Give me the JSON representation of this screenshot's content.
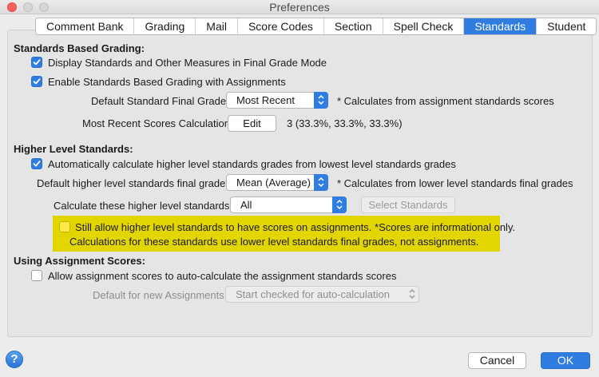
{
  "window": {
    "title": "Preferences"
  },
  "tabs": [
    {
      "label": "Comment Bank",
      "active": false
    },
    {
      "label": "Grading",
      "active": false
    },
    {
      "label": "Mail",
      "active": false
    },
    {
      "label": "Score Codes",
      "active": false
    },
    {
      "label": "Section",
      "active": false
    },
    {
      "label": "Spell Check",
      "active": false
    },
    {
      "label": "Standards",
      "active": true
    },
    {
      "label": "Student",
      "active": false
    }
  ],
  "sbg": {
    "title": "Standards Based Grading:",
    "display_checkbox": {
      "label": "Display Standards and Other Measures in Final Grade Mode",
      "checked": true
    },
    "enable_checkbox": {
      "label": "Enable Standards Based Grading with Assignments",
      "checked": true
    },
    "default_final_grade": {
      "label": "Default Standard Final Grade*:",
      "value": "Most Recent",
      "note": "* Calculates from assignment standards scores"
    },
    "most_recent_calc": {
      "label": "Most Recent Scores Calculation:",
      "button": "Edit",
      "value": "3 (33.3%, 33.3%, 33.3%)"
    }
  },
  "hls": {
    "title": "Higher Level Standards:",
    "auto_checkbox": {
      "label": "Automatically calculate higher level standards grades from lowest level standards grades",
      "checked": true
    },
    "default_final_grade": {
      "label": "Default higher level standards final grade*:",
      "value": "Mean (Average)",
      "note": "* Calculates from lower level standards final grades"
    },
    "calculate": {
      "label": "Calculate these higher level standards:",
      "value": "All",
      "button": "Select Standards"
    },
    "allow_checkbox": {
      "checked": false,
      "line1": "Still allow higher level standards to have scores on assignments.  *Scores are informational only.",
      "line2": "Calculations for these standards use lower level standards final grades, not assignments."
    }
  },
  "uas": {
    "title": "Using Assignment Scores:",
    "allow_checkbox": {
      "label": "Allow assignment scores to auto-calculate the assignment standards scores",
      "checked": false
    },
    "default_new": {
      "label": "Default for new Assignments:",
      "value": "Start checked for auto-calculation"
    }
  },
  "footer": {
    "help": "?",
    "cancel": "Cancel",
    "ok": "OK"
  },
  "colors": {
    "accent": "#2f7de1",
    "highlight": "#e3d600"
  }
}
